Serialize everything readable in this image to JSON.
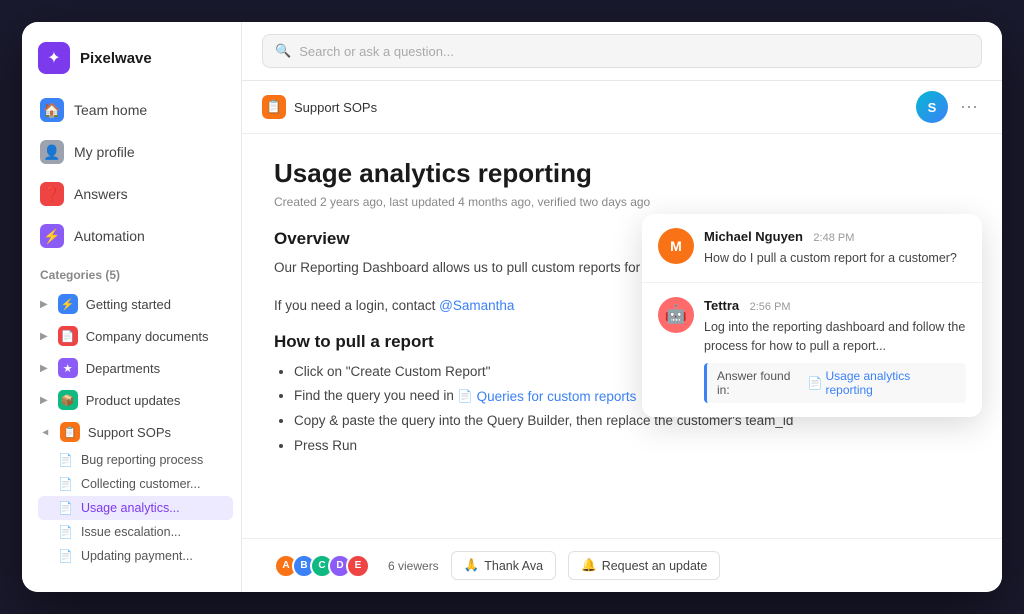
{
  "brand": {
    "name": "Pixelwave",
    "icon": "✦"
  },
  "nav": {
    "items": [
      {
        "id": "team-home",
        "label": "Team home",
        "icon": "🏠",
        "iconColor": "blue"
      },
      {
        "id": "my-profile",
        "label": "My profile",
        "icon": "👤",
        "iconColor": "gray"
      },
      {
        "id": "answers",
        "label": "Answers",
        "icon": "🔴",
        "iconColor": "red"
      },
      {
        "id": "automation",
        "label": "Automation",
        "icon": "⚡",
        "iconColor": "purple"
      }
    ]
  },
  "categories": {
    "header": "Categories (5)",
    "items": [
      {
        "id": "getting-started",
        "label": "Getting started",
        "color": "#3b82f6",
        "icon": "⚡"
      },
      {
        "id": "company-docs",
        "label": "Company documents",
        "color": "#ef4444",
        "icon": "📄"
      },
      {
        "id": "departments",
        "label": "Departments",
        "color": "#8b5cf6",
        "icon": "★"
      },
      {
        "id": "product-updates",
        "label": "Product updates",
        "color": "#10b981",
        "icon": "📦"
      },
      {
        "id": "support-sops",
        "label": "Support SOPs",
        "color": "#f97316",
        "icon": "📋"
      }
    ],
    "subItems": [
      {
        "id": "bug-reporting",
        "label": "Bug reporting process",
        "active": false
      },
      {
        "id": "collecting-customer",
        "label": "Collecting customer...",
        "active": false
      },
      {
        "id": "usage-analytics",
        "label": "Usage analytics...",
        "active": true
      },
      {
        "id": "issue-escalation",
        "label": "Issue escalation...",
        "active": false
      },
      {
        "id": "updating-payment",
        "label": "Updating payment...",
        "active": false
      }
    ]
  },
  "topbar": {
    "search_placeholder": "Search or ask a question..."
  },
  "breadcrumb": {
    "label": "Support SOPs"
  },
  "article": {
    "title": "Usage analytics reporting",
    "meta": "Created 2 years ago, last updated 4 months ago, verified two days ago",
    "overview_title": "Overview",
    "overview_text": "Our Reporting Dashboard allows us to pull custom reports for our",
    "overview_text2": "If you need a login, contact",
    "mention": "@Samantha",
    "how_to_title": "How to pull a report",
    "steps": [
      "Click on \"Create Custom Report\"",
      "Find the query you need in",
      "Copy & paste the query into the Query Builder, then replace the customer's team_id",
      "Press Run"
    ],
    "queries_link": "Queries for custom reports",
    "viewers_count": "6 viewers",
    "thank_ava_label": "Thank Ava",
    "request_update_label": "Request an update"
  },
  "chat_popup": {
    "messages": [
      {
        "id": "msg1",
        "sender": "Michael Nguyen",
        "time": "2:48 PM",
        "text": "How do I pull a custom report for a customer?",
        "avatar_initials": "M",
        "avatar_color": "orange"
      },
      {
        "id": "msg2",
        "sender": "Tettra",
        "time": "2:56 PM",
        "text": "Log into the reporting dashboard and follow the process for how to pull a report...",
        "answer_prefix": "Answer found in:",
        "answer_link": "Usage analytics reporting"
      }
    ]
  },
  "colors": {
    "accent_purple": "#7c3aed",
    "accent_blue": "#3b82f6",
    "accent_orange": "#f97316",
    "active_bg": "#ede9fe",
    "active_text": "#7c3aed"
  }
}
